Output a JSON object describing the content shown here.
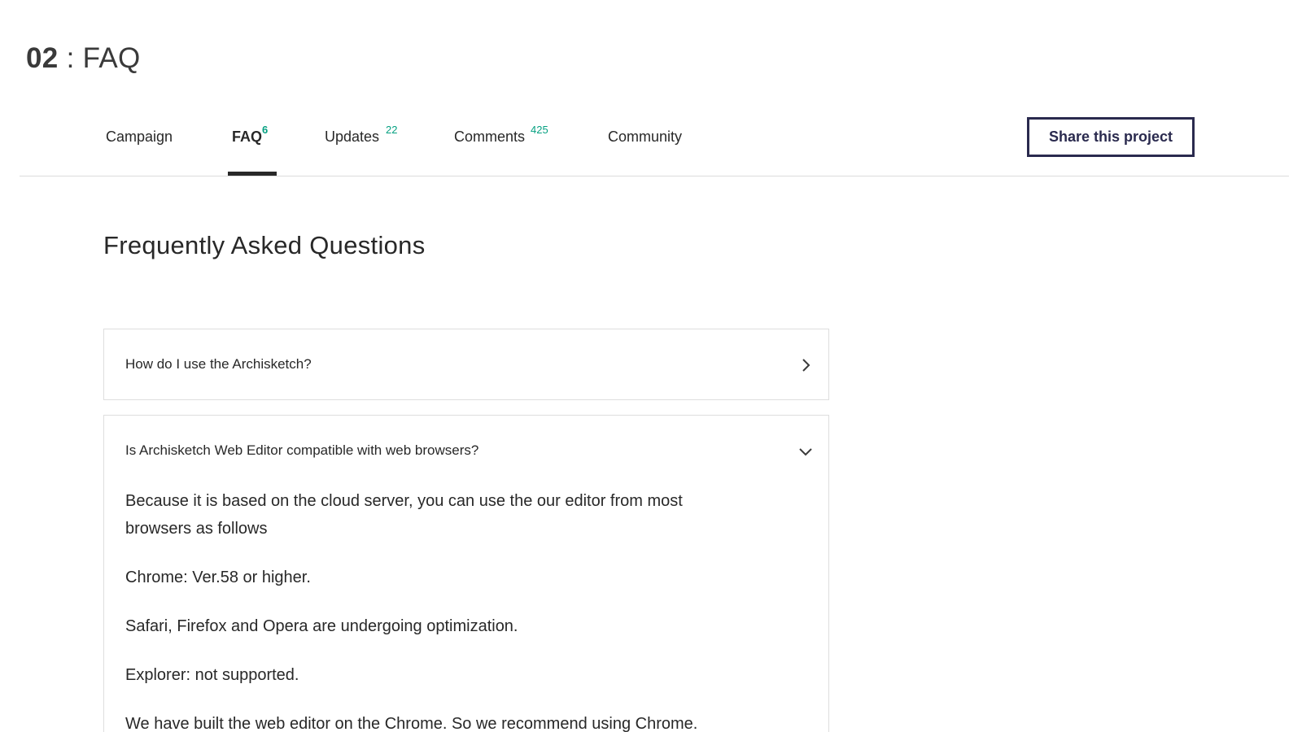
{
  "section": {
    "number": "02",
    "separator": ":",
    "title": "FAQ"
  },
  "tabs": [
    {
      "label": "Campaign",
      "count": ""
    },
    {
      "label": "FAQ",
      "count": "6",
      "active": true
    },
    {
      "label": "Updates",
      "count": "22"
    },
    {
      "label": "Comments",
      "count": "425"
    },
    {
      "label": "Community",
      "count": ""
    }
  ],
  "share_button": {
    "label": "Share this project"
  },
  "faq": {
    "heading": "Frequently Asked Questions",
    "items": [
      {
        "question": "How do I use the Archisketch?",
        "expanded": false,
        "icon": "chevron-right-icon"
      },
      {
        "question": "Is Archisketch Web Editor compatible with web browsers?",
        "expanded": true,
        "icon": "chevron-down-icon",
        "answer": [
          "Because it is based on the cloud server, you can use the our editor from most browsers as follows",
          "Chrome: Ver.58 or higher.",
          "Safari, Firefox and Opera are undergoing optimization.",
          "Explorer: not supported.",
          "We have built the web editor on the Chrome. So we recommend using Chrome."
        ]
      }
    ]
  },
  "colors": {
    "accent_count": "#05a081",
    "share_border": "#2a2a4e",
    "text": "#282828",
    "divider": "#dcdcdc"
  }
}
